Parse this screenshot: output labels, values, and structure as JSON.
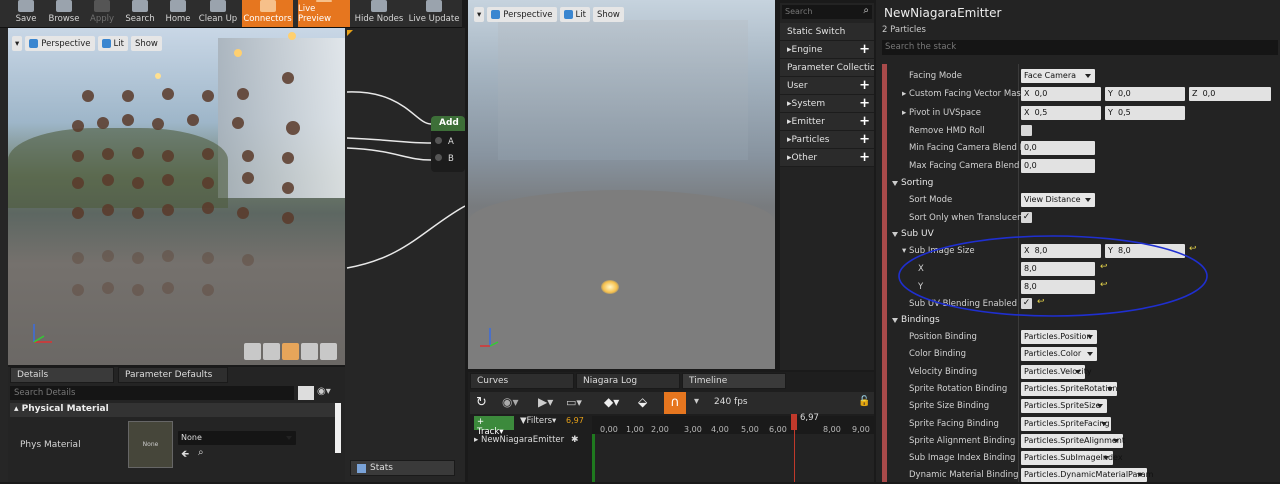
{
  "toolbar": {
    "buttons": [
      {
        "label": "Save"
      },
      {
        "label": "Browse"
      },
      {
        "label": "Apply"
      },
      {
        "label": "Search"
      },
      {
        "label": "Home"
      },
      {
        "label": "Clean Up"
      },
      {
        "label": "Connectors"
      },
      {
        "label": "Live Preview"
      },
      {
        "label": "Hide Nodes"
      },
      {
        "label": "Live Update"
      }
    ]
  },
  "viewport_left": {
    "mode": "Perspective",
    "lighting": "Lit",
    "show": "Show"
  },
  "viewport_right": {
    "mode": "Perspective",
    "lighting": "Lit",
    "show": "Show"
  },
  "graph": {
    "node_title": "Add",
    "pins": [
      "A",
      "B"
    ]
  },
  "left_tabs": {
    "details": "Details",
    "param_defaults": "Parameter Defaults",
    "search_placeholder": "Search Details",
    "section": "Physical Material",
    "phys_label": "Phys Material",
    "thumb_label": "None",
    "dropdown": "None"
  },
  "stats_tab": "Stats",
  "palette": {
    "search_placeholder": "Search",
    "items": [
      "Static Switch",
      "Engine",
      "Parameter Collection",
      "User",
      "System",
      "Emitter",
      "Particles",
      "Other"
    ]
  },
  "emitter": {
    "title": "NewNiagaraEmitter",
    "count": "2 Particles",
    "search_placeholder": "Search the stack"
  },
  "props": {
    "facing_mode": {
      "label": "Facing Mode",
      "value": "Face Camera"
    },
    "custom_facing": {
      "label": "Custom Facing Vector Mask",
      "x": "0,0",
      "y": "0,0",
      "z": "0,0"
    },
    "pivot": {
      "label": "Pivot in UVSpace",
      "x": "0,5",
      "y": "0,5"
    },
    "remove_hmd": {
      "label": "Remove HMD Roll"
    },
    "min_blend": {
      "label": "Min Facing Camera Blend Dist",
      "value": "0,0"
    },
    "max_blend": {
      "label": "Max Facing Camera Blend Dis",
      "value": "0,0"
    },
    "sorting": "Sorting",
    "sort_mode": {
      "label": "Sort Mode",
      "value": "View Distance"
    },
    "sort_only": {
      "label": "Sort Only when Translucent"
    },
    "subuv": "Sub UV",
    "sub_image": {
      "label": "Sub Image Size",
      "x": "8,0",
      "y": "8,0"
    },
    "sub_x": {
      "label": "X",
      "value": "8,0"
    },
    "sub_y": {
      "label": "Y",
      "value": "8,0"
    },
    "subuv_blend": {
      "label": "Sub UV Blending Enabled"
    },
    "bindings": "Bindings",
    "binding_rows": [
      {
        "label": "Position Binding",
        "value": "Particles.Position"
      },
      {
        "label": "Color Binding",
        "value": "Particles.Color"
      },
      {
        "label": "Velocity Binding",
        "value": "Particles.Velocity"
      },
      {
        "label": "Sprite Rotation Binding",
        "value": "Particles.SpriteRotation"
      },
      {
        "label": "Sprite Size Binding",
        "value": "Particles.SpriteSize"
      },
      {
        "label": "Sprite Facing Binding",
        "value": "Particles.SpriteFacing"
      },
      {
        "label": "Sprite Alignment Binding",
        "value": "Particles.SpriteAlignment"
      },
      {
        "label": "Sub Image Index Binding",
        "value": "Particles.SubImageIndex"
      },
      {
        "label": "Dynamic Material Binding",
        "value": "Particles.DynamicMaterialParam"
      }
    ]
  },
  "timeline": {
    "tabs": [
      "Curves",
      "Niagara Log",
      "Timeline"
    ],
    "track": "Track",
    "filters": "Filters",
    "time": "6,97",
    "fps": "240 fps",
    "row": "NewNiagaraEmitter",
    "ticks": [
      "0,00",
      "1,00",
      "2,00",
      "3,00",
      "4,00",
      "5,00",
      "6,00",
      "8,00",
      "9,00"
    ],
    "playhead": "6,97"
  },
  "colors": {
    "accent": "#e6761f",
    "annotation": "#1f2fd0"
  }
}
